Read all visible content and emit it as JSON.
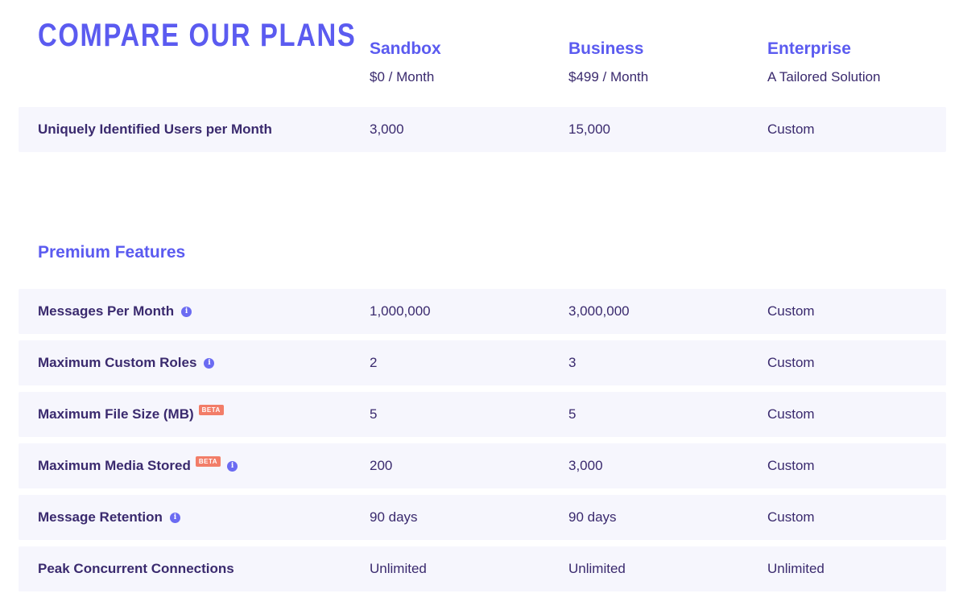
{
  "header": {
    "title": "COMPARE OUR PLANS"
  },
  "plans": [
    {
      "name": "Sandbox",
      "price": "$0 / Month"
    },
    {
      "name": "Business",
      "price": "$499 / Month"
    },
    {
      "name": "Enterprise",
      "price": "A Tailored Solution"
    }
  ],
  "base_rows": [
    {
      "label": "Uniquely Identified Users per Month",
      "values": [
        "3,000",
        "15,000",
        "Custom"
      ]
    }
  ],
  "premium": {
    "title": "Premium Features",
    "badge_label": "BETA",
    "rows": [
      {
        "label": "Messages Per Month",
        "info": true,
        "beta": false,
        "values": [
          "1,000,000",
          "3,000,000",
          "Custom"
        ]
      },
      {
        "label": "Maximum Custom Roles",
        "info": true,
        "beta": false,
        "values": [
          "2",
          "3",
          "Custom"
        ]
      },
      {
        "label": "Maximum File Size (MB)",
        "info": false,
        "beta": true,
        "values": [
          "5",
          "5",
          "Custom"
        ]
      },
      {
        "label": "Maximum Media Stored",
        "info": true,
        "beta": true,
        "values": [
          "200",
          "3,000",
          "Custom"
        ]
      },
      {
        "label": "Message Retention",
        "info": true,
        "beta": false,
        "values": [
          "90 days",
          "90 days",
          "Custom"
        ]
      },
      {
        "label": "Peak Concurrent Connections",
        "info": false,
        "beta": false,
        "values": [
          "Unlimited",
          "Unlimited",
          "Unlimited"
        ]
      }
    ]
  },
  "colors": {
    "accent": "#5b5bf0",
    "text": "#3a2a6e",
    "row_bg": "#f6f6fd",
    "beta_badge": "#f27d68"
  },
  "icons": {
    "info": "info-icon"
  }
}
